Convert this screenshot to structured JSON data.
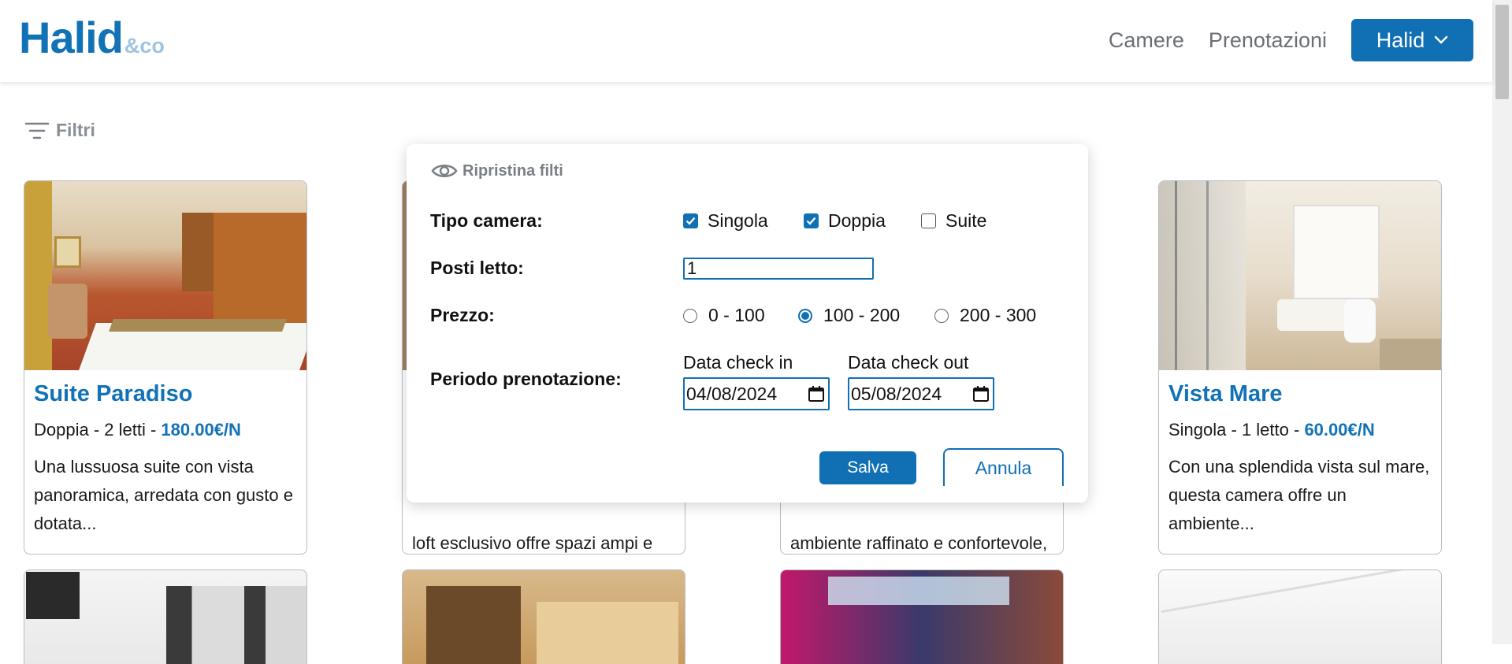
{
  "header": {
    "logo_main": "Halid",
    "logo_sub": "&co",
    "nav": [
      "Camere",
      "Prenotazioni"
    ],
    "user_label": "Halid"
  },
  "filters": {
    "toggle_label": "Filtri"
  },
  "modal": {
    "reset_label": "Ripristina filti",
    "room_type_label": "Tipo camera:",
    "room_types": [
      {
        "label": "Singola",
        "checked": true
      },
      {
        "label": "Doppia",
        "checked": true
      },
      {
        "label": "Suite",
        "checked": false
      }
    ],
    "beds_label": "Posti letto:",
    "beds_value": "1",
    "price_label": "Prezzo:",
    "prices": [
      {
        "label": "0 - 100",
        "selected": false
      },
      {
        "label": "100 - 200",
        "selected": true
      },
      {
        "label": "200 - 300",
        "selected": false
      }
    ],
    "period_label": "Periodo prenotazione:",
    "checkin_label": "Data check in",
    "checkin_value": "04/08/2024",
    "checkout_label": "Data check out",
    "checkout_value": "05/08/2024",
    "save_label": "Salva",
    "cancel_label": "Annula"
  },
  "rooms": [
    {
      "title": "Suite Paradiso",
      "meta": "Doppia - 2 letti - ",
      "price": "180.00€/N",
      "desc": "Una lussuosa suite con vista panoramica, arredata con gusto e dotata..."
    },
    {
      "title": "",
      "meta": "",
      "price": "",
      "desc": "loft esclusivo offre spazi ampi e una..."
    },
    {
      "title": "",
      "meta": "",
      "price": "",
      "desc": "ambiente raffinato e confortevole, con dettagli..."
    },
    {
      "title": "Vista Mare",
      "meta": "Singola - 1 letto - ",
      "price": "60.00€/N",
      "desc": "Con una splendida vista sul mare, questa camera offre un ambiente..."
    }
  ],
  "colors": {
    "primary": "#1170b4",
    "title": "#1272b6",
    "muted": "#6b6f75"
  }
}
